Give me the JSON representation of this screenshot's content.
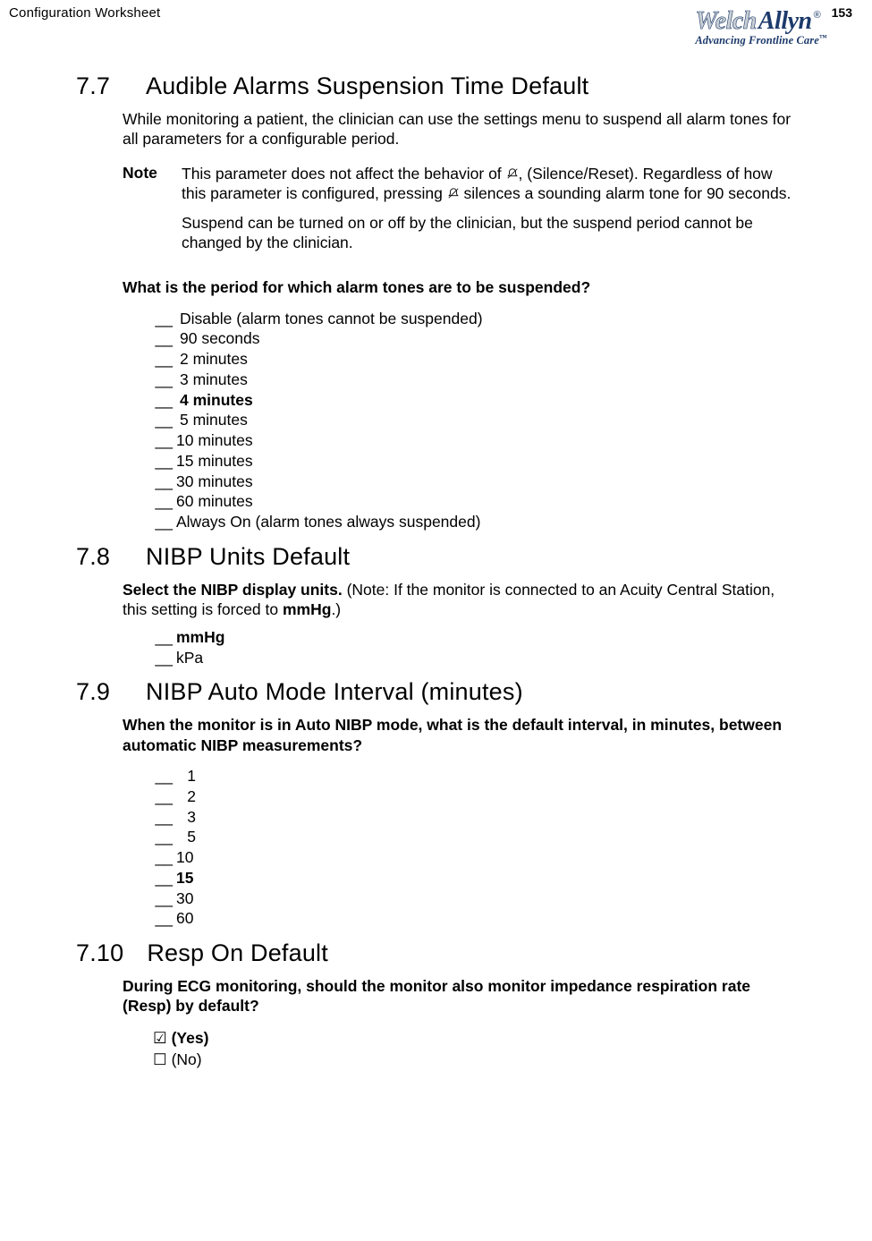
{
  "header": {
    "doc_title": "Configuration Worksheet",
    "page_number": "153",
    "logo_welch": "Welch",
    "logo_allyn": "Allyn",
    "logo_reg": "®",
    "tagline": "Advancing Frontline Care",
    "tagline_tm": "™"
  },
  "s77": {
    "num": "7.7",
    "title": "Audible Alarms Suspension Time Default",
    "intro": "While monitoring a patient, the clinician can use the settings menu to suspend all alarm tones for all parameters for a configurable period.",
    "note_label": "Note",
    "note_p1a": "This parameter does not affect the behavior of ",
    "note_p1b": ", (Silence/Reset). Regardless of how this parameter is configured, pressing ",
    "note_p1c": " silences a sounding alarm tone for 90 seconds.",
    "note_p2": "Suspend can be turned on or off by the clinician, but the suspend period cannot be changed by the clinician.",
    "question": "What is the period for which alarm tones are to be suspended?",
    "options": [
      {
        "blank": "__",
        "label": " Disable (alarm tones cannot be suspended)",
        "bold": false,
        "pad": " "
      },
      {
        "blank": "__",
        "label": " 90 seconds",
        "bold": false,
        "pad": " "
      },
      {
        "blank": "__",
        "label": " 2 minutes",
        "bold": false,
        "pad": " "
      },
      {
        "blank": "__",
        "label": " 3 minutes",
        "bold": false,
        "pad": " "
      },
      {
        "blank": "__",
        "label": " 4 minutes",
        "bold": true,
        "pad": " "
      },
      {
        "blank": "__",
        "label": " 5 minutes",
        "bold": false,
        "pad": " "
      },
      {
        "blank": "__",
        "label": " 10 minutes",
        "bold": false,
        "pad": ""
      },
      {
        "blank": "__",
        "label": " 15 minutes",
        "bold": false,
        "pad": ""
      },
      {
        "blank": "__",
        "label": " 30 minutes",
        "bold": false,
        "pad": ""
      },
      {
        "blank": "__",
        "label": " 60 minutes",
        "bold": false,
        "pad": ""
      },
      {
        "blank": "__",
        "label": " Always On (alarm tones always suspended)",
        "bold": false,
        "pad": ""
      }
    ]
  },
  "s78": {
    "num": "7.8",
    "title": "NIBP Units Default",
    "lead_bold": "Select the NIBP display units.",
    "lead_rest_a": " (Note: If the monitor is connected to an Acuity Central Station, this setting is forced to ",
    "lead_rest_b": "mmHg",
    "lead_rest_c": ".)",
    "options": [
      {
        "blank": "__",
        "label": " mmHg",
        "bold": true
      },
      {
        "blank": "__",
        "label": " kPa",
        "bold": false
      }
    ]
  },
  "s79": {
    "num": "7.9",
    "title": "NIBP Auto Mode Interval (minutes)",
    "question": "When the monitor is in Auto NIBP mode, what is the default interval, in minutes, between automatic NIBP measurements?",
    "options": [
      {
        "blank": "__",
        "num": "1",
        "bold": false,
        "pad": " "
      },
      {
        "blank": "__",
        "num": "2",
        "bold": false,
        "pad": " "
      },
      {
        "blank": "__",
        "num": "3",
        "bold": false,
        "pad": " "
      },
      {
        "blank": "__",
        "num": "5",
        "bold": false,
        "pad": " "
      },
      {
        "blank": "__",
        "num": "10",
        "bold": false,
        "pad": ""
      },
      {
        "blank": "__",
        "num": "15",
        "bold": true,
        "pad": ""
      },
      {
        "blank": "__",
        "num": "30",
        "bold": false,
        "pad": ""
      },
      {
        "blank": "__",
        "num": "60",
        "bold": false,
        "pad": ""
      }
    ]
  },
  "s710": {
    "num": "7.10",
    "title": "Resp On Default",
    "question": "During ECG monitoring, should the monitor also monitor impedance respiration rate (Resp) by default?",
    "yes_box": "☑",
    "yes_label": " (Yes)",
    "no_box": "☐",
    "no_label": " (No)"
  }
}
